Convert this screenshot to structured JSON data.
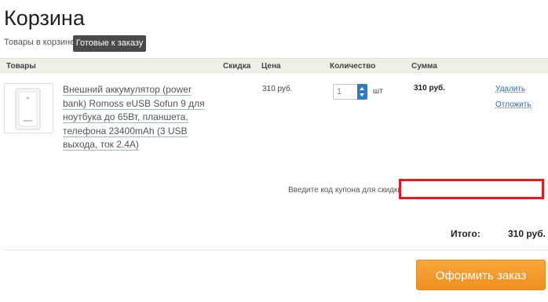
{
  "page": {
    "title": "Корзина",
    "in_cart_label": "Товары в корзине:",
    "ready_tab": "Готовые к заказу"
  },
  "table": {
    "headers": {
      "products": "Товары",
      "discount": "Скидка",
      "price": "Цена",
      "quantity": "Количество",
      "sum": "Сумма"
    }
  },
  "item": {
    "name": "Внешний аккумулятор (power bank) Romoss eUSB Sofun 9 для ноутбука до 65Вт, планшета, телефона 23400mAh (3 USB выхода, ток 2.4А)",
    "price": "310 руб.",
    "quantity": "1",
    "unit": "шт",
    "sum": "310 руб.",
    "delete_label": "Удалить",
    "defer_label": "Отложить"
  },
  "coupon": {
    "label": "Введите код купона для скидки:",
    "value": ""
  },
  "total": {
    "label": "Итого:",
    "value": "310 руб."
  },
  "checkout_label": "Оформить заказ",
  "colors": {
    "accent": "#2f79c9",
    "checkout": "#f39a2c",
    "highlight": "#e21c1c",
    "header_bg": "#f2efe6"
  }
}
